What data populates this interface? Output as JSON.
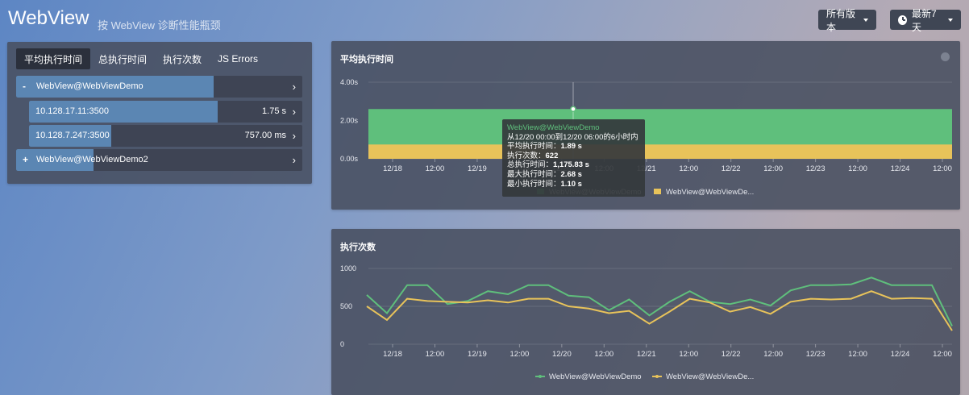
{
  "header": {
    "title": "WebView",
    "subtitle": "按 WebView 诊断性能瓶颈",
    "version_button": "所有版本",
    "range_button": "最新7天"
  },
  "left_panel": {
    "tabs": [
      {
        "label": "平均执行时间",
        "active": true
      },
      {
        "label": "总执行时间",
        "active": false
      },
      {
        "label": "执行次数",
        "active": false
      },
      {
        "label": "JS Errors",
        "active": false
      }
    ],
    "rows": [
      {
        "sign": "-",
        "label": "WebView@WebViewDemo",
        "value": "",
        "fill": 0.69
      },
      {
        "sign": "",
        "label": "10.128.17.11:3500",
        "value": "1.75 s",
        "fill": 0.69
      },
      {
        "sign": "",
        "label": "10.128.7.247:3500",
        "value": "757.00 ms",
        "fill": 0.3
      },
      {
        "sign": "+",
        "label": "WebView@WebViewDemo2",
        "value": "",
        "fill": 0.27
      }
    ]
  },
  "colors": {
    "series1": "#5fbf7c",
    "series2": "#e8c35a",
    "bar_fill": "#5b86b3"
  },
  "charts": {
    "avg_time_title": "平均执行时间",
    "count_title": "执行次数"
  },
  "tooltip": {
    "title": "WebView@WebViewDemo",
    "range": "从12/20 00:00到12/20 06:00的6小时内",
    "avg_label": "平均执行时间：",
    "avg_value": "1.89 s",
    "count_label": "执行次数：",
    "count_value": "622",
    "total_label": "总执行时间：",
    "total_value": "1,175.83 s",
    "max_label": "最大执行时间：",
    "max_value": "2.68 s",
    "min_label": "最小执行时间：",
    "min_value": "1.10 s"
  },
  "chart_data": [
    {
      "type": "area",
      "title": "平均执行时间",
      "y_ticks": [
        "4.00s",
        "2.00s",
        "0.00s"
      ],
      "ylim": [
        0,
        4
      ],
      "x_ticks": [
        "12/18",
        "12:00",
        "12/19",
        "12:00",
        "12/20",
        "12:00",
        "12/21",
        "12:00",
        "12/22",
        "12:00",
        "12/23",
        "12:00",
        "12/24",
        "12:00"
      ],
      "series": [
        {
          "name": "WebView@WebViewDemo",
          "values": [
            2.6,
            2.6,
            2.6,
            2.6,
            2.6,
            2.6,
            2.6,
            2.6,
            2.6,
            2.6,
            2.6,
            2.6,
            2.6,
            2.6,
            2.6
          ]
        },
        {
          "name": "WebView@WebViewDe...",
          "values": [
            0.75,
            0.75,
            0.75,
            0.75,
            0.75,
            0.75,
            0.75,
            0.75,
            0.75,
            0.75,
            0.75,
            0.75,
            0.75,
            0.75,
            0.75
          ]
        }
      ],
      "legend": "bottom"
    },
    {
      "type": "line",
      "title": "执行次数",
      "y_ticks": [
        "1000",
        "500",
        "0"
      ],
      "ylim": [
        0,
        1000
      ],
      "x_ticks": [
        "12/18",
        "12:00",
        "12/19",
        "12:00",
        "12/20",
        "12:00",
        "12/21",
        "12:00",
        "12/22",
        "12:00",
        "12/23",
        "12:00",
        "12/24",
        "12:00"
      ],
      "series": [
        {
          "name": "WebView@WebViewDemo",
          "values": [
            650,
            410,
            780,
            780,
            530,
            570,
            700,
            660,
            780,
            780,
            640,
            620,
            450,
            590,
            380,
            560,
            700,
            560,
            530,
            590,
            510,
            710,
            780,
            780,
            790,
            880,
            780,
            780,
            780,
            240
          ]
        },
        {
          "name": "WebView@WebViewDe...",
          "values": [
            500,
            320,
            600,
            570,
            560,
            550,
            580,
            550,
            600,
            600,
            500,
            470,
            410,
            440,
            270,
            430,
            600,
            550,
            430,
            490,
            400,
            560,
            600,
            590,
            600,
            700,
            600,
            610,
            600,
            180
          ]
        }
      ],
      "legend": "bottom"
    }
  ]
}
